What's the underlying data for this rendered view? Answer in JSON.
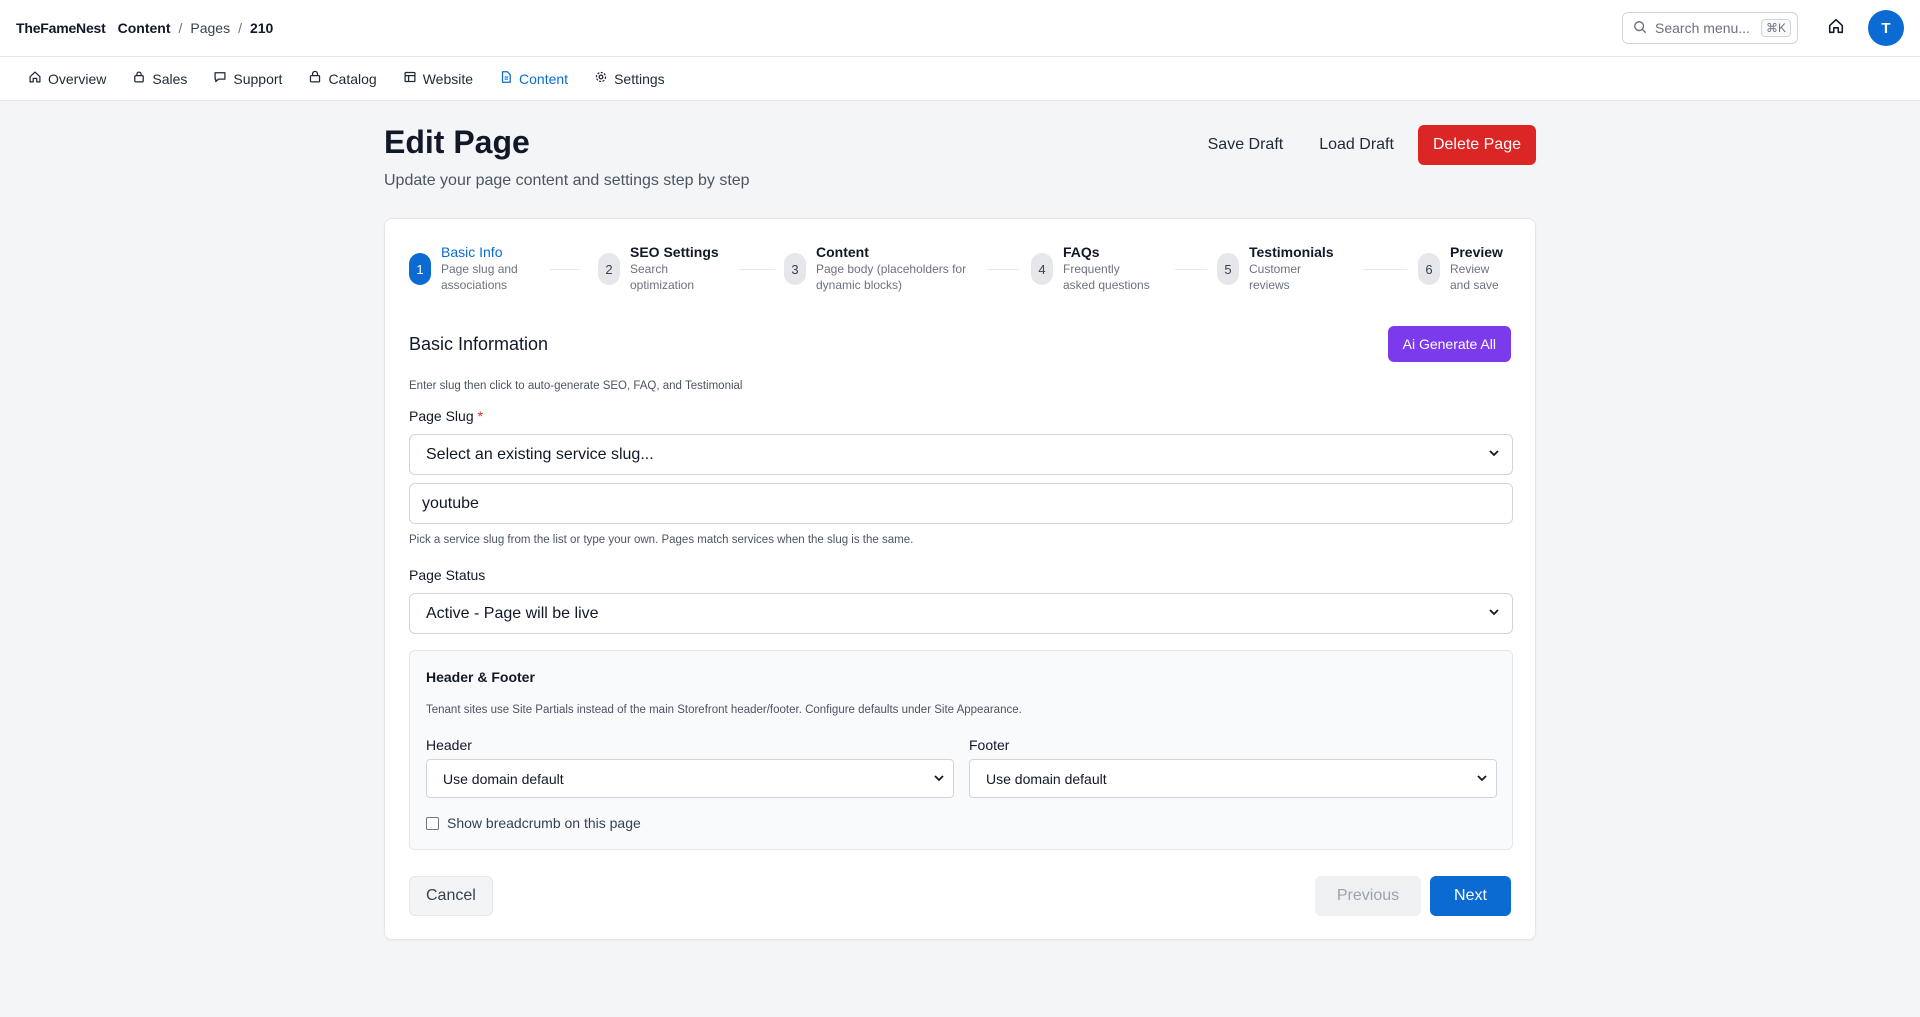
{
  "breadcrumb": {
    "brand": "TheFameNest",
    "section": "Content",
    "parent": "Pages",
    "current": "210",
    "separator": "/"
  },
  "search": {
    "placeholder": "Search menu...",
    "shortcut": "⌘K",
    "icon": "search-icon"
  },
  "user": {
    "avatar_initial": "T",
    "avatar_color": "#0b6bd3"
  },
  "nav": {
    "items": [
      {
        "label": "Overview",
        "icon": "home-icon",
        "active": false
      },
      {
        "label": "Sales",
        "icon": "bag-icon",
        "active": false
      },
      {
        "label": "Support",
        "icon": "chat-icon",
        "active": false
      },
      {
        "label": "Catalog",
        "icon": "box-icon",
        "active": false
      },
      {
        "label": "Website",
        "icon": "layout-icon",
        "active": false
      },
      {
        "label": "Content",
        "icon": "document-icon",
        "active": true
      },
      {
        "label": "Settings",
        "icon": "gear-icon",
        "active": false
      }
    ]
  },
  "header": {
    "title": "Edit Page",
    "subtitle": "Update your page content and settings step by step",
    "save_draft": "Save Draft",
    "load_draft": "Load Draft",
    "delete_page": "Delete Page"
  },
  "steps": [
    {
      "number": "1",
      "title": "Basic Info",
      "desc": [
        "Page slug and",
        "associations"
      ],
      "active": true
    },
    {
      "number": "2",
      "title": "SEO Settings",
      "desc": [
        "Search",
        "optimization"
      ],
      "active": false
    },
    {
      "number": "3",
      "title": "Content",
      "desc": [
        "Page body (placeholders for",
        "dynamic blocks)"
      ],
      "active": false
    },
    {
      "number": "4",
      "title": "FAQs",
      "desc": [
        "Frequently",
        "asked questions"
      ],
      "active": false
    },
    {
      "number": "5",
      "title": "Testimonials",
      "desc": [
        "Customer",
        "reviews"
      ],
      "active": false
    },
    {
      "number": "6",
      "title": "Preview",
      "desc": [
        "Review",
        "and save"
      ],
      "active": false
    }
  ],
  "basic": {
    "section_title": "Basic Information",
    "ai_button": "Ai Generate All",
    "ai_hint": "Enter slug then click to auto-generate SEO, FAQ, and Testimonial",
    "slug_label": "Page Slug",
    "required_mark": "*",
    "slug_select_value": "Select an existing service slug...",
    "slug_input_value": "youtube",
    "slug_hint": "Pick a service slug from the list or type your own. Pages match services when the slug is the same.",
    "status_label": "Page Status",
    "status_value": "Active - Page will be live"
  },
  "header_footer": {
    "title": "Header & Footer",
    "hint": "Tenant sites use Site Partials instead of the main Storefront header/footer. Configure defaults under Site Appearance.",
    "header_label": "Header",
    "header_value": "Use domain default",
    "footer_label": "Footer",
    "footer_value": "Use domain default",
    "breadcrumb_checkbox": "Show breadcrumb on this page",
    "breadcrumb_checked": false
  },
  "footer_actions": {
    "cancel": "Cancel",
    "previous": "Previous",
    "next": "Next"
  },
  "colors": {
    "primary": "#0b6bd3",
    "danger": "#dc2626",
    "ai": "#7c3aed"
  }
}
